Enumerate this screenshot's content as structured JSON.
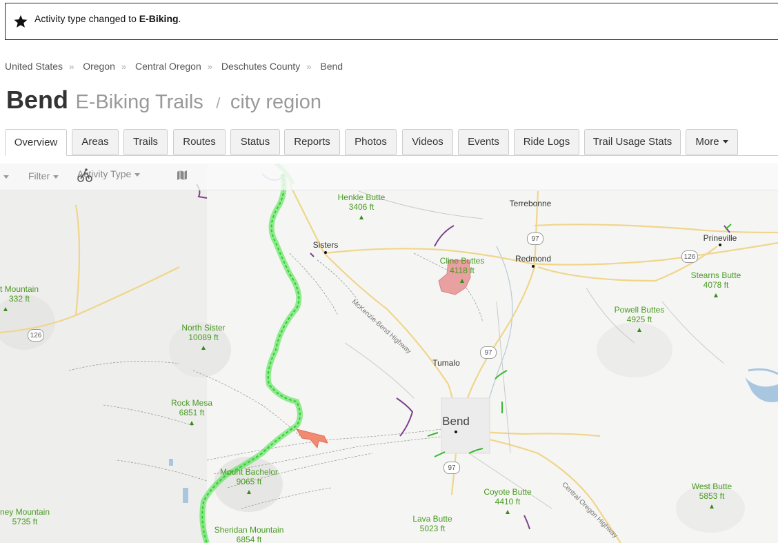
{
  "notice": {
    "icon": "star-icon",
    "prefix": "Activity type changed to ",
    "activity": "E-Biking",
    "suffix": "."
  },
  "breadcrumb": [
    "United States",
    "Oregon",
    "Central Oregon",
    "Deschutes County",
    "Bend"
  ],
  "title": {
    "place": "Bend",
    "subtitle": "E-Biking Trails",
    "slash": "/",
    "scope": "city region"
  },
  "tabs": [
    {
      "label": "Overview",
      "active": true
    },
    {
      "label": "Areas"
    },
    {
      "label": "Trails"
    },
    {
      "label": "Routes"
    },
    {
      "label": "Status"
    },
    {
      "label": "Reports"
    },
    {
      "label": "Photos"
    },
    {
      "label": "Videos"
    },
    {
      "label": "Events"
    },
    {
      "label": "Ride Logs"
    },
    {
      "label": "Trail Usage Stats"
    },
    {
      "label": "More"
    }
  ],
  "map_toolbar": {
    "filter": "Filter",
    "activity_type": "Activity Type"
  },
  "map": {
    "peaks": [
      {
        "name": "Henkle Butte",
        "elev": "3406 ft"
      },
      {
        "name": "Cline Buttes",
        "elev": "4118 ft"
      },
      {
        "name": "Stearns Butte",
        "elev": "4078 ft"
      },
      {
        "name": "Powell Buttes",
        "elev": "4925 ft"
      },
      {
        "name": "North Sister",
        "elev": "10089 ft"
      },
      {
        "name": "Rock Mesa",
        "elev": "6851 ft"
      },
      {
        "name": "Mount Bachelor",
        "elev": "9065 ft"
      },
      {
        "name": "Sheridan Mountain",
        "elev": "6854 ft"
      },
      {
        "name": "Coyote Butte",
        "elev": "4410 ft"
      },
      {
        "name": "Lava Butte",
        "elev": "5023 ft"
      },
      {
        "name": "West Butte",
        "elev": "5853 ft"
      },
      {
        "name": "t Mountain",
        "elev": "332 ft"
      },
      {
        "name": "ney Mountain",
        "elev": "5735 ft"
      }
    ],
    "cities": [
      "Terrebonne",
      "Sisters",
      "Redmond",
      "Prineville",
      "Tumalo",
      "Bend"
    ],
    "highways": [
      "97",
      "126",
      "97",
      "97",
      "126"
    ],
    "roads": [
      "McKenzie-Bend Highway",
      "Central Oregon Highway"
    ]
  },
  "colors": {
    "trail_green": "#3ee03e",
    "trail_purple": "#7b3f8c",
    "area_red": "#e8a0a0",
    "road_yellow": "#f2d77a"
  }
}
